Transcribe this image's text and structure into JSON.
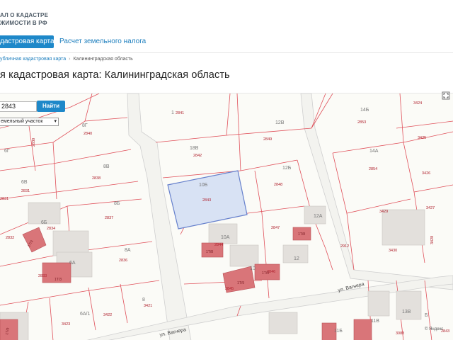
{
  "header": {
    "logo_line1": "АЛ О КАДАСТРЕ",
    "logo_line2": "ЖИМОСТИ В РФ"
  },
  "nav": {
    "active_tab": "дастровая карта",
    "tab_tax": "Расчет земельного налога"
  },
  "breadcrumb": {
    "link": "убличная кадастровая карта",
    "separator": "›",
    "current": "Калининградская область"
  },
  "page": {
    "title": "я кадастровая карта: Калининградская область"
  },
  "search": {
    "value": "2843",
    "button_label": "Найти",
    "type_value": "емельный участок",
    "type_arrow": "▾"
  },
  "map": {
    "credit": "© Яндекс",
    "streets": [
      "ул. Вагнера",
      "ул. Вагнера"
    ],
    "parcel_ids": [
      "1",
      "8Г",
      "6Г",
      "8В",
      "6В",
      "8Б",
      "6Б",
      "8А",
      "6А",
      "6А/1",
      "8",
      "18В",
      "10Б",
      "10А",
      "10",
      "12В",
      "12Б",
      "12А",
      "12",
      "14Б",
      "14А",
      "11Б",
      "11В",
      "13В",
      "Б"
    ],
    "cad_numbers": [
      "2841",
      "2840",
      "2830",
      "2838",
      "2831",
      "2837",
      "2832",
      "2836",
      "2833",
      "2831",
      "2834",
      "3422",
      "3423",
      "3421",
      "2842",
      "2843",
      "2844",
      "2845",
      "2846",
      "2847",
      "2848",
      "2849",
      "2853",
      "3424",
      "3425",
      "2854",
      "3426",
      "3429",
      "3427",
      "3430",
      "3428",
      "2912",
      "3088",
      "2843"
    ],
    "building_labels": [
      "1Т/3",
      "1Т/3",
      "1Т/8",
      "1Т/9",
      "1Т/3",
      "1Т/8",
      "1Т/9"
    ],
    "colors": {
      "parcel_border": "#e0505a",
      "selected_fill": "#d8e2f4",
      "selected_border": "#6680cc",
      "building_fill": "#d97579",
      "house_fill": "#e3e0dc"
    }
  },
  "icons": {
    "fullscreen": "expand-icon"
  }
}
